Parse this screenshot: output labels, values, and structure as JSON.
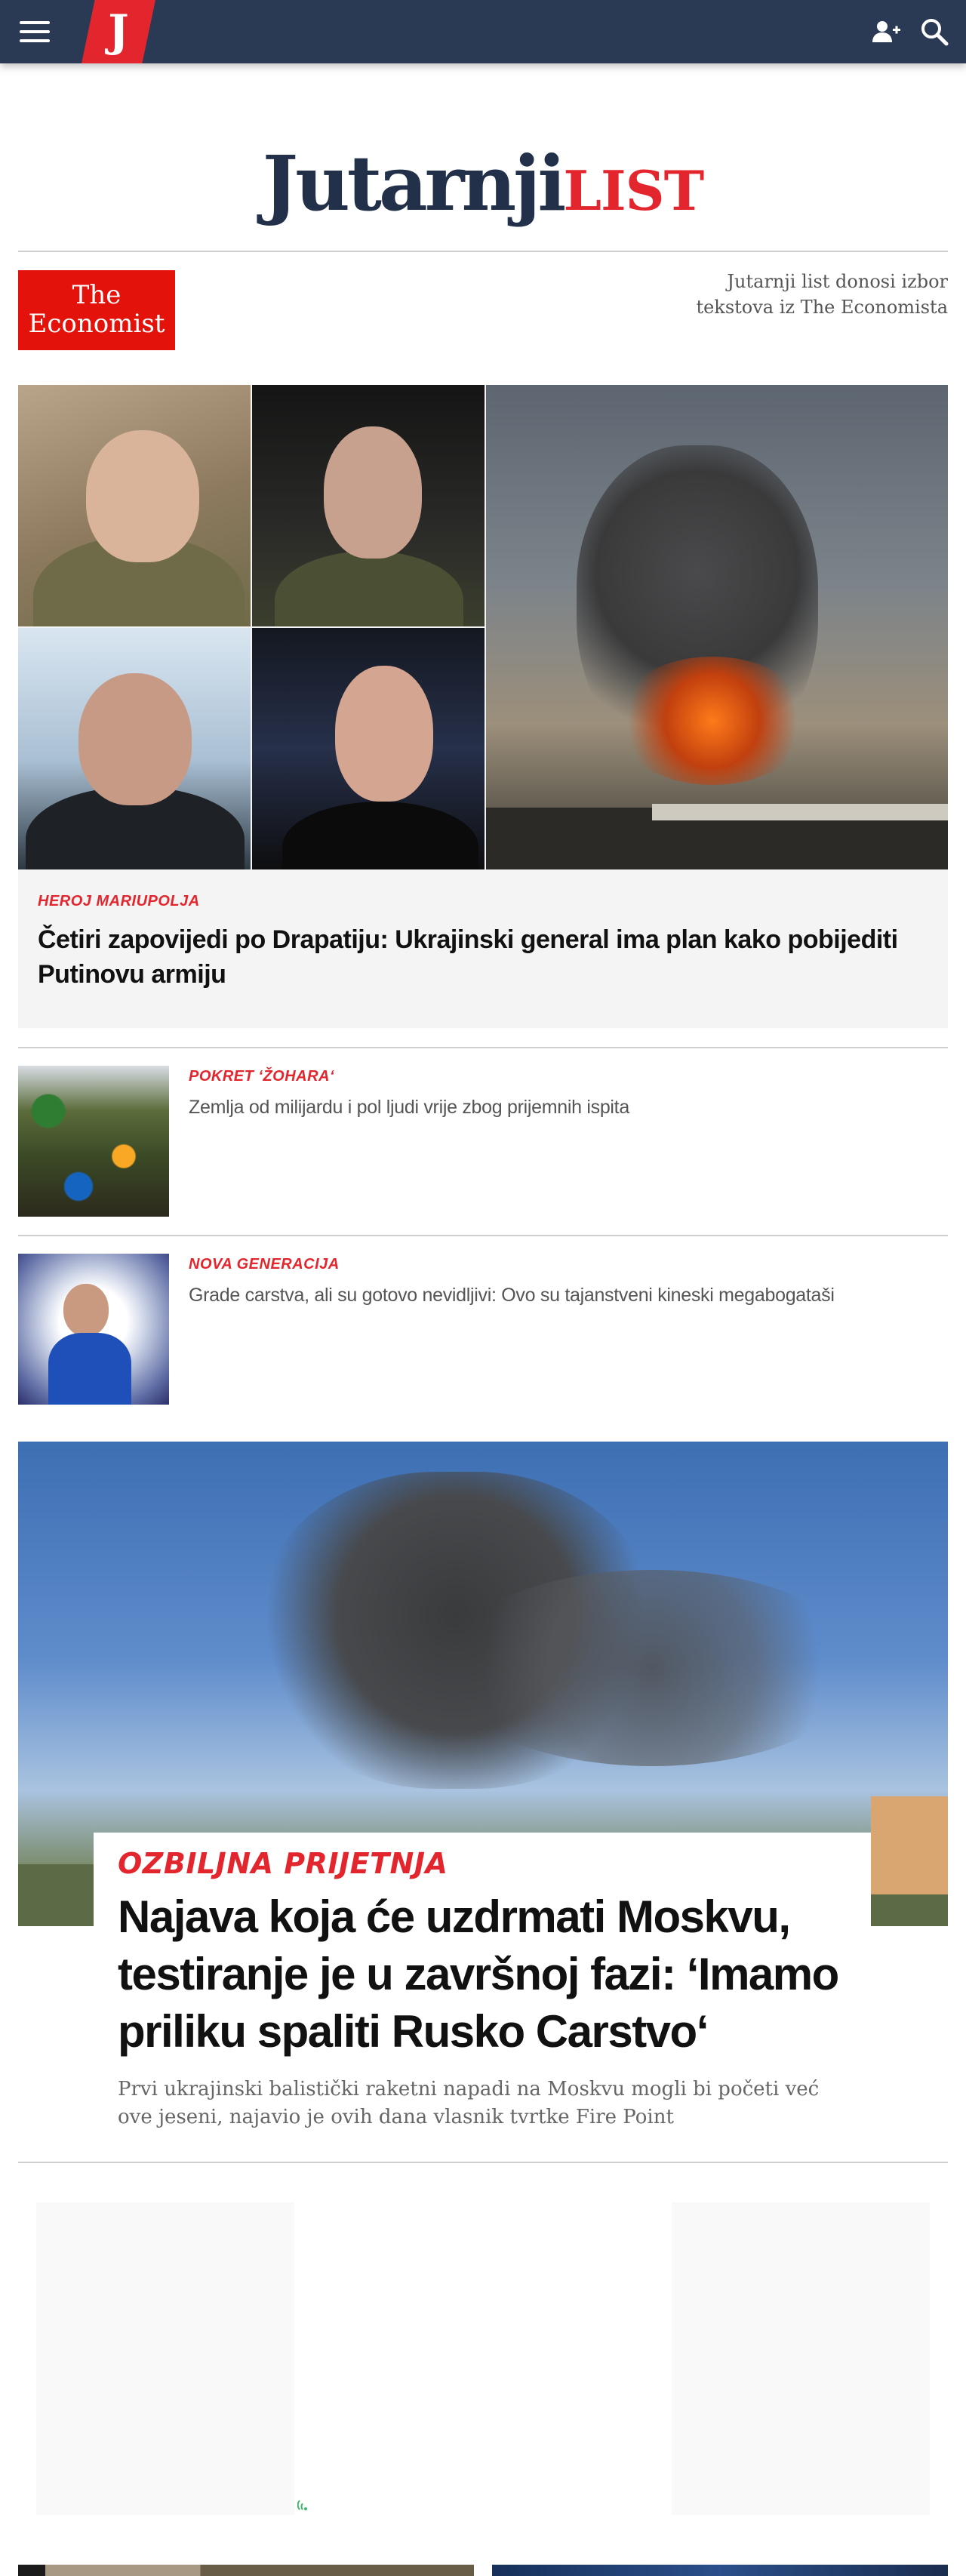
{
  "header": {
    "logo_letter": "J",
    "menu_icon": "hamburger-icon",
    "account_icon": "add-user-icon",
    "search_icon": "search-icon"
  },
  "masthead": {
    "name_part1": "Jutarnji",
    "name_part2": "LIST"
  },
  "economist": {
    "logo_line1": "The",
    "logo_line2": "Economist",
    "note": "Jutarnji list donosi izbor tekstova iz The Economista"
  },
  "hero": {
    "kicker": "HEROJ MARIUPOLJA",
    "title": "Četiri zapovijedi po Drapatiju: Ukrajinski general ima plan kako pobijediti Putinovu armiju"
  },
  "items": [
    {
      "kicker": "POKRET ‘ŽOHARA‘",
      "title": "Zemlja od milijardu i pol ljudi vrije zbog prijemnih ispita"
    },
    {
      "kicker": "NOVA GENERACIJA",
      "title": "Grade carstva, ali su gotovo nevidljivi: Ovo su tajanstveni kineski megabogataši"
    }
  ],
  "feature": {
    "kicker": "OZBILJNA PRIJETNJA",
    "title": "Najava koja će uzdrmati Moskvu, testiranje je u završnoj fazi: ‘Imamo priliku spaliti Rusko Carstvo‘",
    "lead": "Prvi ukrajinski balistički raketni napadi na Moskvu mogli bi početi već ove jeseni, najavio je ovih dana vlasnik tvrtke Fire Point"
  },
  "colors": {
    "navy": "#2a3a55",
    "brand_red": "#e3262e",
    "economist_red": "#e3120b"
  }
}
